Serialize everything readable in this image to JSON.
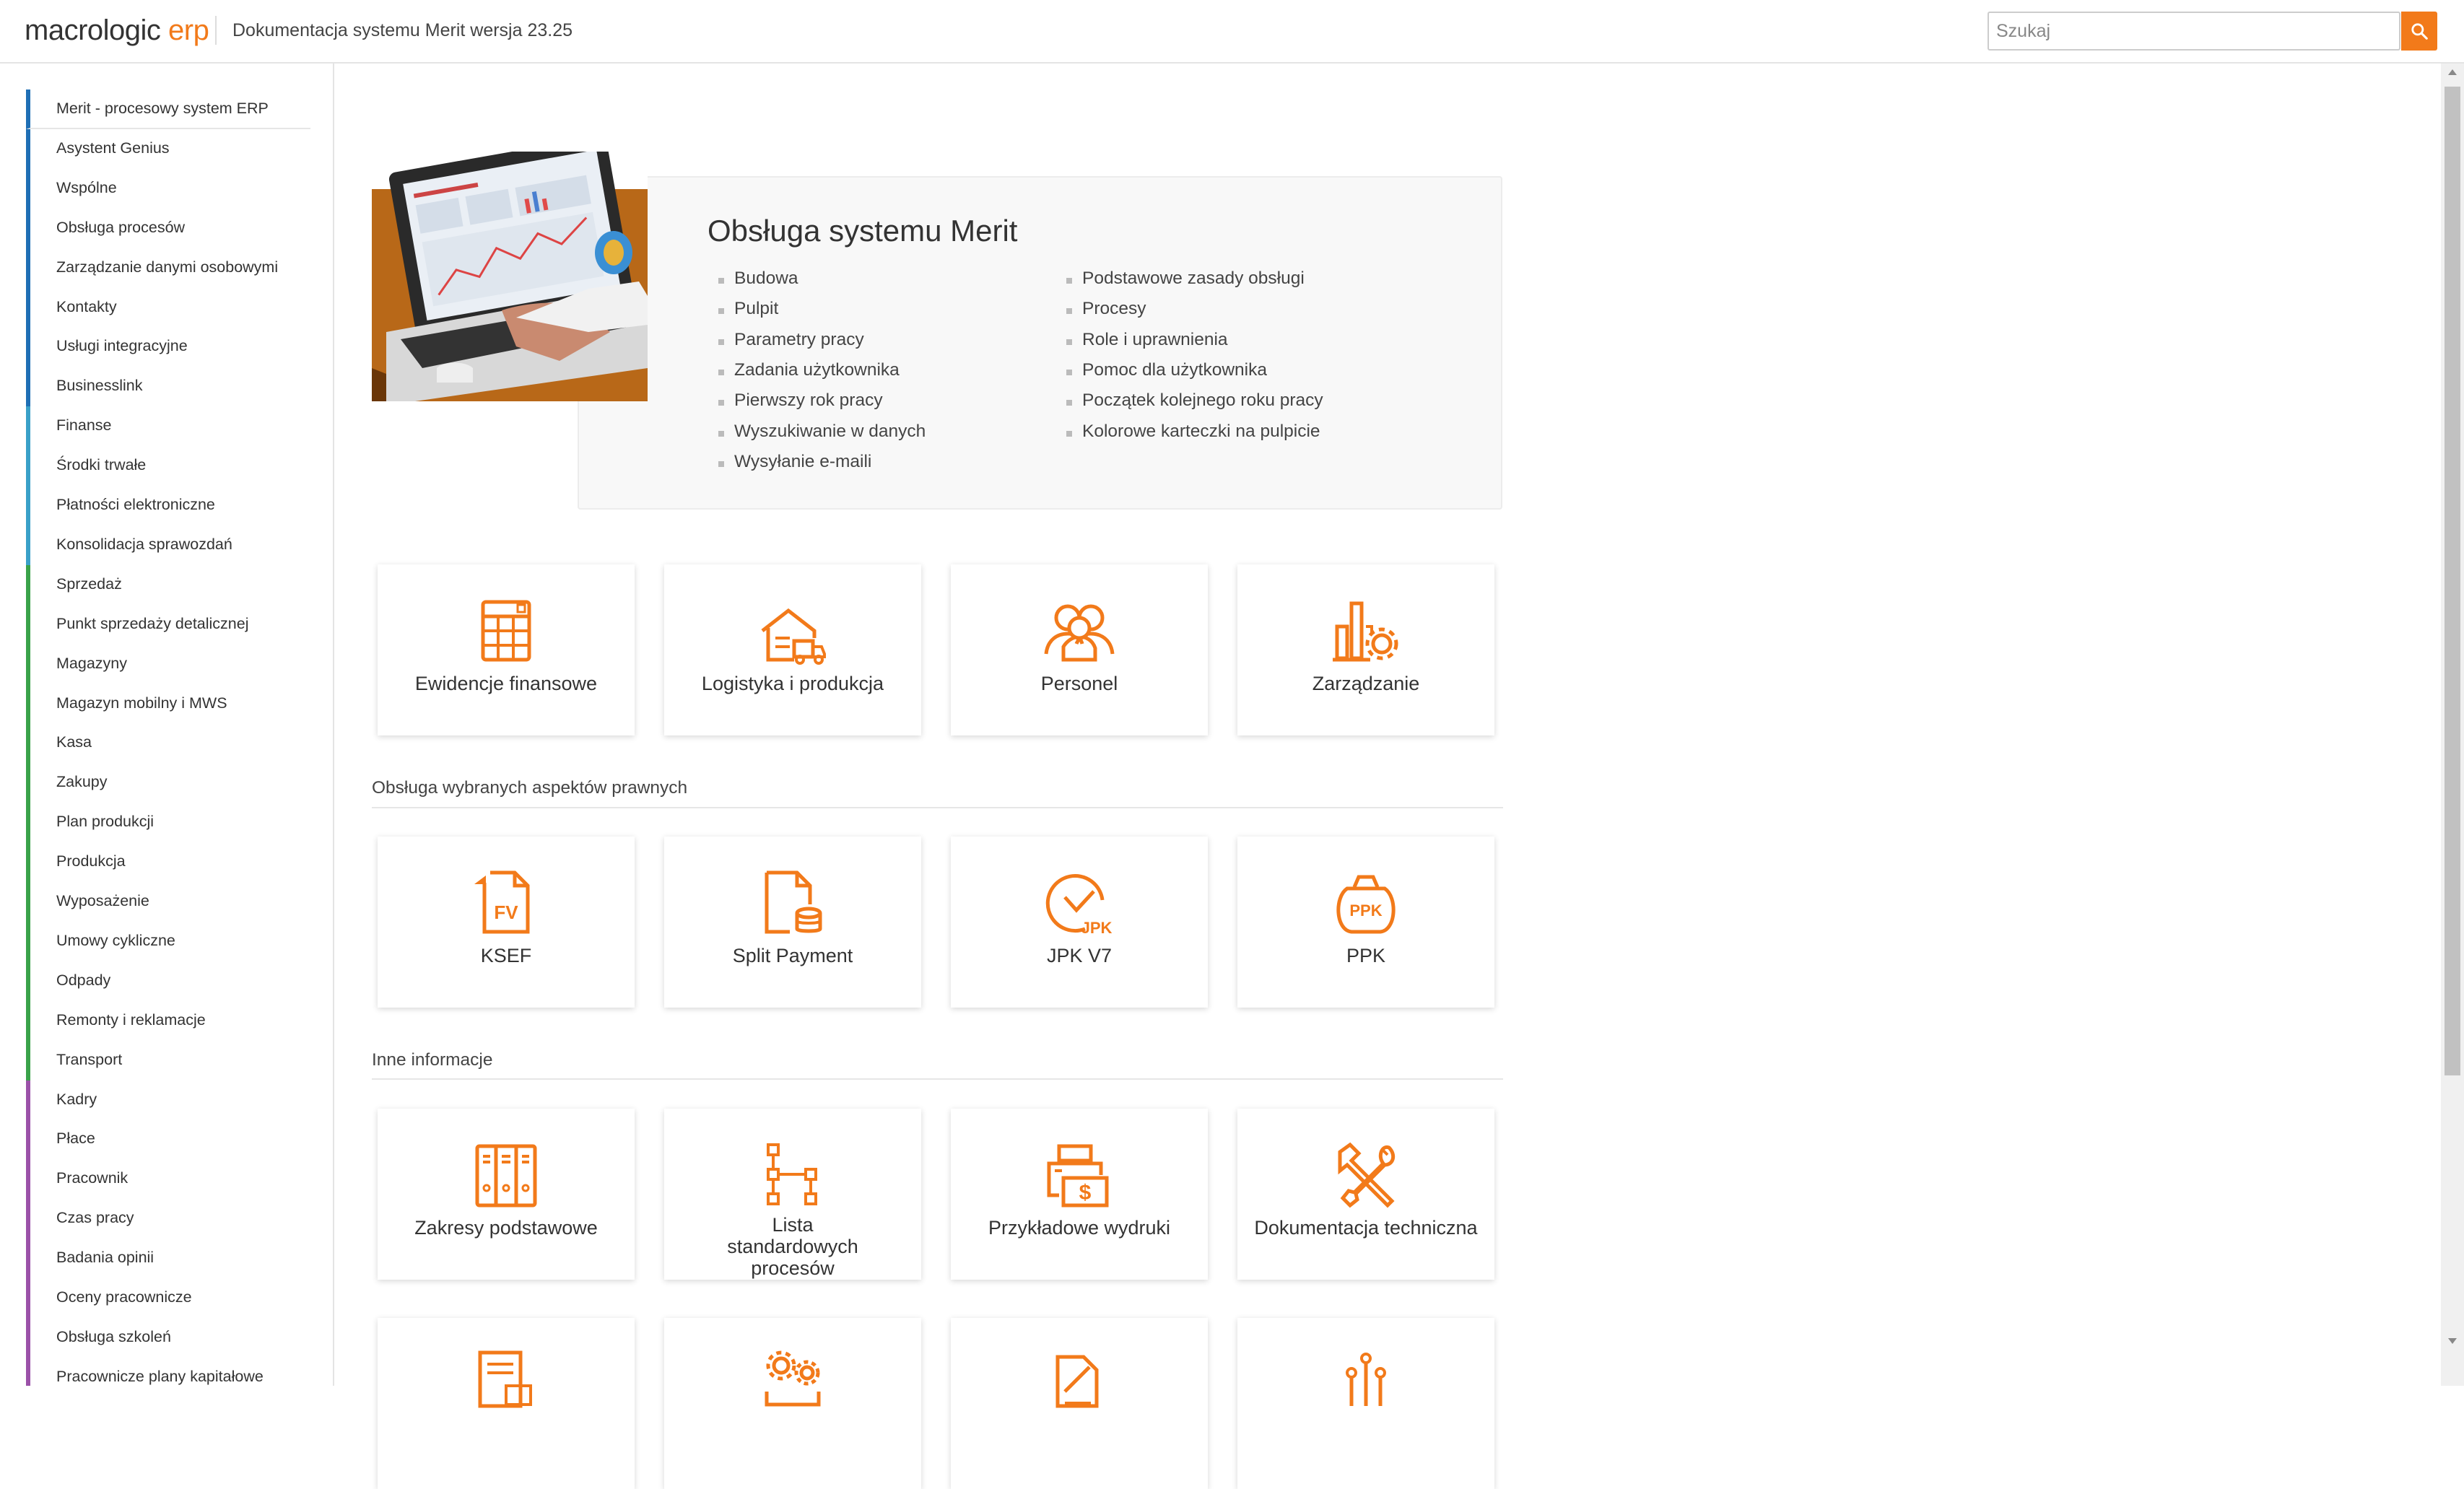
{
  "header": {
    "logo_main": "macrologic",
    "logo_accent": "erp",
    "doc_title": "Dokumentacja systemu Merit wersja 23.25",
    "search_placeholder": "Szukaj"
  },
  "sidebar": {
    "items": [
      {
        "label": "Merit - procesowy system ERP",
        "color": "#1f6fb5"
      },
      {
        "label": "Asystent Genius",
        "color": "#1f6fb5"
      },
      {
        "label": "Wspólne",
        "color": "#1f6fb5"
      },
      {
        "label": "Obsługa procesów",
        "color": "#1f6fb5"
      },
      {
        "label": "Zarządzanie danymi osobowymi",
        "color": "#1f6fb5"
      },
      {
        "label": "Kontakty",
        "color": "#1f6fb5"
      },
      {
        "label": "Usługi integracyjne",
        "color": "#1f6fb5"
      },
      {
        "label": "Businesslink",
        "color": "#1f6fb5"
      },
      {
        "label": "Finanse",
        "color": "#3aa0c8"
      },
      {
        "label": "Środki trwałe",
        "color": "#3aa0c8"
      },
      {
        "label": "Płatności elektroniczne",
        "color": "#3aa0c8"
      },
      {
        "label": "Konsolidacja sprawozdań",
        "color": "#3aa0c8"
      },
      {
        "label": "Sprzedaż",
        "color": "#3aa24a"
      },
      {
        "label": "Punkt sprzedaży detalicznej",
        "color": "#3aa24a"
      },
      {
        "label": "Magazyny",
        "color": "#3aa24a"
      },
      {
        "label": "Magazyn mobilny i MWS",
        "color": "#3aa24a"
      },
      {
        "label": "Kasa",
        "color": "#3aa24a"
      },
      {
        "label": "Zakupy",
        "color": "#3aa24a"
      },
      {
        "label": "Plan produkcji",
        "color": "#3aa24a"
      },
      {
        "label": "Produkcja",
        "color": "#3aa24a"
      },
      {
        "label": "Wyposażenie",
        "color": "#3aa24a"
      },
      {
        "label": "Umowy cykliczne",
        "color": "#3aa24a"
      },
      {
        "label": "Odpady",
        "color": "#3aa24a"
      },
      {
        "label": "Remonty i reklamacje",
        "color": "#3aa24a"
      },
      {
        "label": "Transport",
        "color": "#3aa24a"
      },
      {
        "label": "Kadry",
        "color": "#9b51a8"
      },
      {
        "label": "Płace",
        "color": "#9b51a8"
      },
      {
        "label": "Pracownik",
        "color": "#9b51a8"
      },
      {
        "label": "Czas pracy",
        "color": "#9b51a8"
      },
      {
        "label": "Badania opinii",
        "color": "#9b51a8"
      },
      {
        "label": "Oceny pracownicze",
        "color": "#9b51a8"
      },
      {
        "label": "Obsługa szkoleń",
        "color": "#9b51a8"
      },
      {
        "label": "Pracownicze plany kapitałowe",
        "color": "#9b51a8"
      }
    ]
  },
  "hero": {
    "title": "Obsługa systemu Merit",
    "links_left": [
      "Budowa",
      "Pulpit",
      "Parametry pracy",
      "Zadania użytkownika",
      "Pierwszy rok pracy",
      "Wyszukiwanie w danych",
      "Wysyłanie e-maili"
    ],
    "links_right": [
      "Podstawowe zasady obsługi",
      "Procesy",
      "Role i uprawnienia",
      "Pomoc dla użytkownika",
      "Początek kolejnego roku pracy",
      "Kolorowe karteczki na pulpicie"
    ]
  },
  "accent_color": "#f27a1a",
  "sections": [
    {
      "title": "",
      "cards": [
        {
          "label": "Ewidencje finansowe",
          "icon": "spreadsheet-icon"
        },
        {
          "label": "Logistyka i produkcja",
          "icon": "warehouse-truck-icon"
        },
        {
          "label": "Personel",
          "icon": "people-icon"
        },
        {
          "label": "Zarządzanie",
          "icon": "chart-gear-icon"
        }
      ]
    },
    {
      "title": "Obsługa wybranych aspektów prawnych",
      "cards": [
        {
          "label": "KSEF",
          "icon": "invoice-fv-icon"
        },
        {
          "label": "Split Payment",
          "icon": "document-coins-icon"
        },
        {
          "label": "JPK V7",
          "icon": "jpk-check-icon"
        },
        {
          "label": "PPK",
          "icon": "ppk-bag-icon"
        }
      ]
    },
    {
      "title": "Inne informacje",
      "cards": [
        {
          "label": "Zakresy podstawowe",
          "icon": "binders-icon"
        },
        {
          "label": "Lista standardowych procesów",
          "icon": "flowchart-icon"
        },
        {
          "label": "Przykładowe wydruki",
          "icon": "printer-icon"
        },
        {
          "label": "Dokumentacja techniczna",
          "icon": "tools-icon"
        }
      ]
    }
  ],
  "partial_cards": [
    {
      "icon": "report-icon"
    },
    {
      "icon": "gears-icon"
    },
    {
      "icon": "edit-document-icon"
    },
    {
      "icon": "circuit-icon"
    }
  ]
}
